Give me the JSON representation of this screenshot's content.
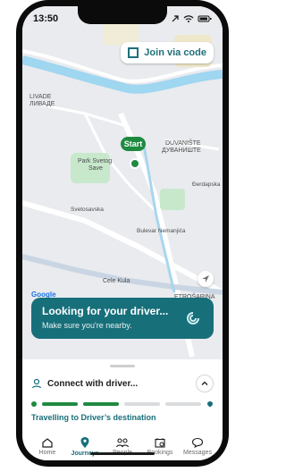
{
  "status_bar": {
    "time": "13:50",
    "icons": [
      "arrow-icon",
      "wifi-icon",
      "battery-icon"
    ]
  },
  "map": {
    "join_label": "Join via code",
    "labels": [
      "LIVADE",
      "ЛИВАДЕ",
      "DUVANIŠTE",
      "ДУВАНИШТЕ",
      "Park Svetog",
      "Save",
      "Đerdapska",
      "Svetosavska",
      "Bulevar Nemanjića",
      "Cele Kula",
      "ETROŠARINA",
      "Google"
    ],
    "start_label": "Start",
    "colors": {
      "brand": "#176f7a",
      "start": "#1e8a40",
      "water": "#9fd6f0",
      "park": "#c8e8cc"
    }
  },
  "card": {
    "title": "Looking for your driver...",
    "subtitle": "Make sure you're nearby."
  },
  "sheet": {
    "connect_label": "Connect with driver...",
    "progress": {
      "segments": 4,
      "completed": 2
    },
    "travel_label": "Travelling to Driver’s destination"
  },
  "tabs": [
    {
      "label": "Home",
      "icon": "home-icon",
      "active": false
    },
    {
      "label": "Journeys",
      "icon": "location-pin-icon",
      "active": true
    },
    {
      "label": "People",
      "icon": "people-icon",
      "active": false
    },
    {
      "label": "Bookings",
      "icon": "calendar-icon",
      "active": false
    },
    {
      "label": "Messages",
      "icon": "message-bubble-icon",
      "active": false
    }
  ]
}
